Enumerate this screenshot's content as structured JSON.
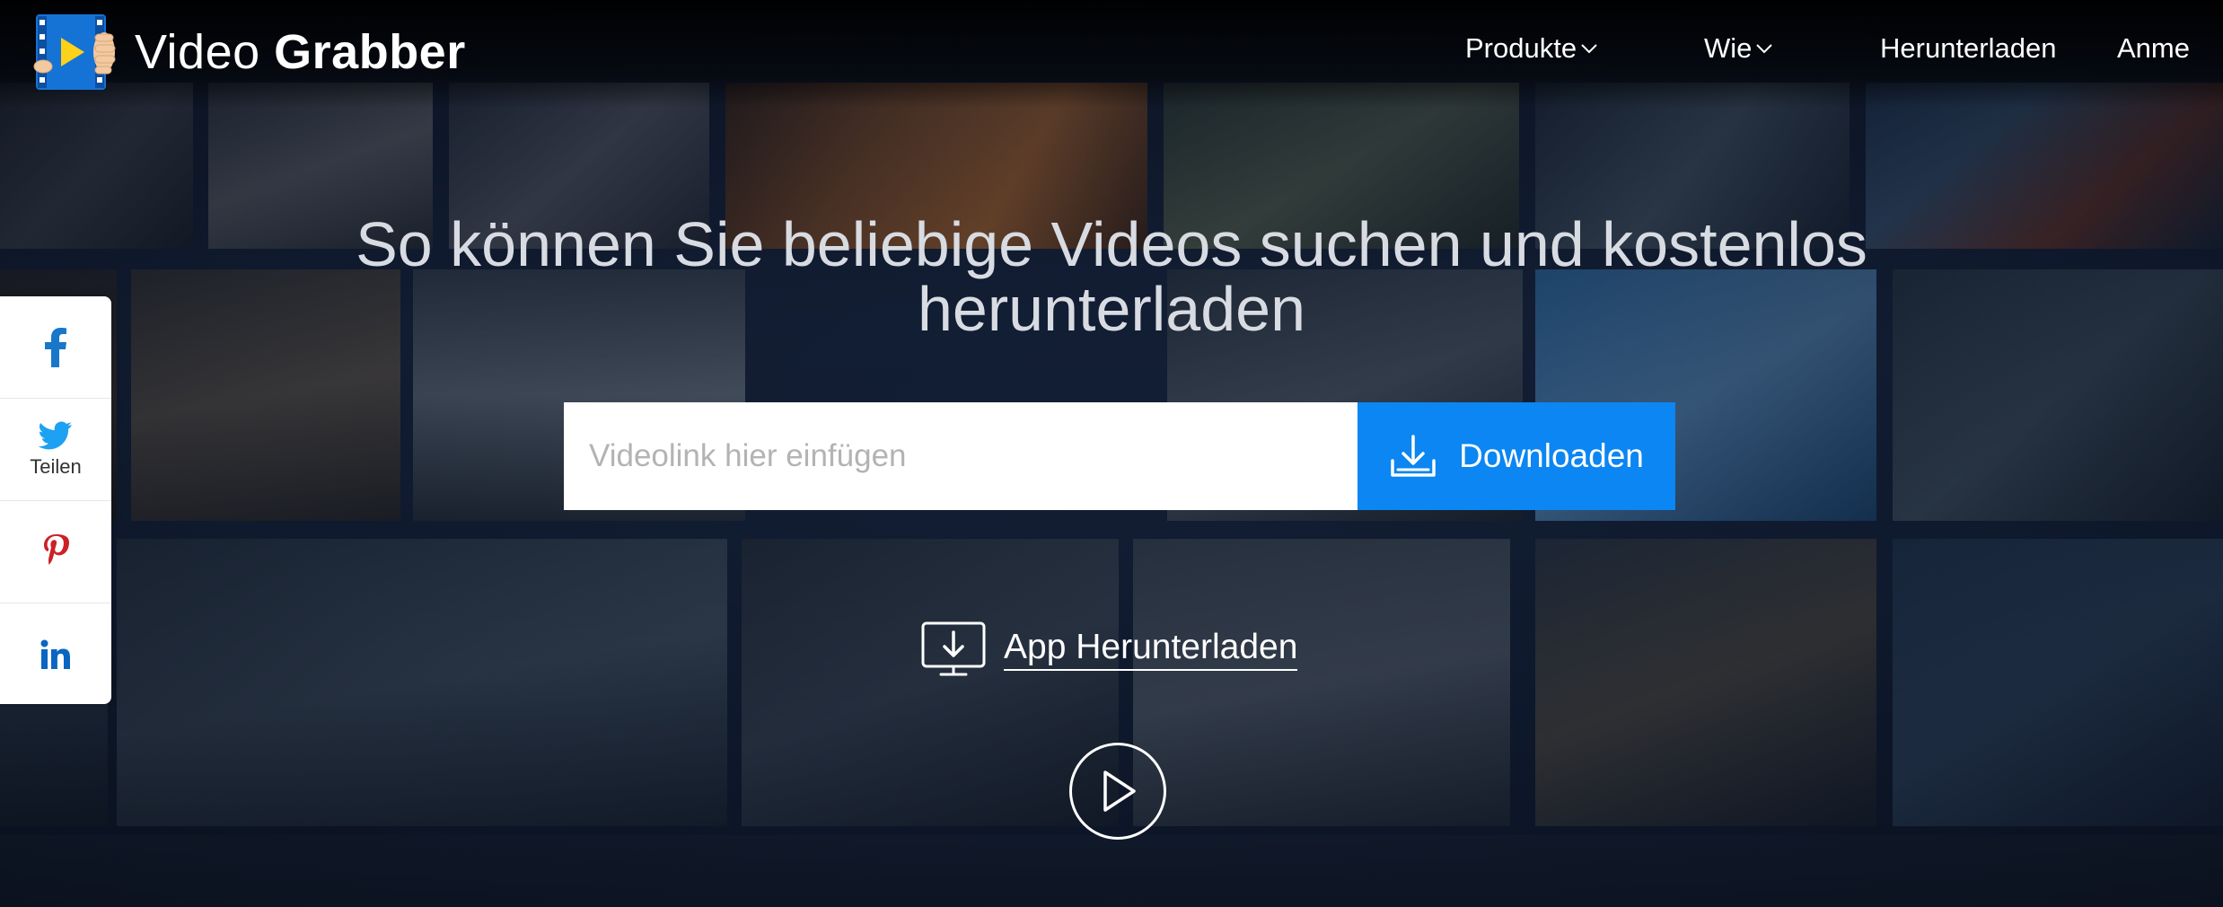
{
  "logo": {
    "text_light": "Video",
    "text_bold": "Grabber"
  },
  "nav": {
    "items": [
      {
        "label": "Produkte",
        "has_dropdown": true
      },
      {
        "label": "Wie",
        "has_dropdown": true
      },
      {
        "label": "Herunterladen",
        "has_dropdown": false
      },
      {
        "label": "Anme",
        "has_dropdown": false
      }
    ]
  },
  "hero": {
    "headline_line1": "So können Sie beliebige Videos suchen und kostenlos",
    "headline_line2": "herunterladen"
  },
  "search": {
    "placeholder": "Videolink hier einfügen",
    "value": "",
    "button_label": "Downloaden"
  },
  "app_download": {
    "label": "App Herunterladen"
  },
  "social": {
    "items": [
      {
        "icon": "facebook-icon",
        "label": ""
      },
      {
        "icon": "twitter-icon",
        "label": "Teilen"
      },
      {
        "icon": "pinterest-icon",
        "label": ""
      },
      {
        "icon": "linkedin-icon",
        "label": ""
      }
    ]
  },
  "colors": {
    "accent_blue": "#0b86f2",
    "facebook": "#1877c9",
    "twitter": "#1da1f2",
    "pinterest": "#cb2027",
    "linkedin": "#0a66c2"
  }
}
